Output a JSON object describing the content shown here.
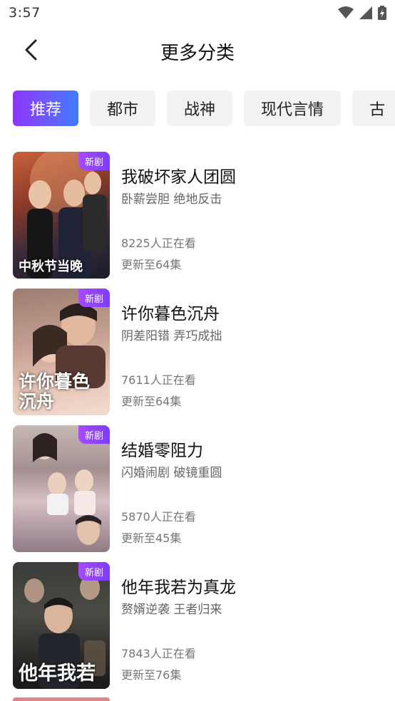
{
  "status": {
    "time": "3:57"
  },
  "header": {
    "title": "更多分类"
  },
  "tabs": [
    {
      "label": "推荐",
      "active": true
    },
    {
      "label": "都市",
      "active": false
    },
    {
      "label": "战神",
      "active": false
    },
    {
      "label": "现代言情",
      "active": false
    },
    {
      "label": "古",
      "active": false
    }
  ],
  "colors": {
    "accent_start": "#8b35ff",
    "accent_end": "#3f7dff",
    "badge": "#9a45ff"
  },
  "dramas": [
    {
      "badge": "新剧",
      "cover_text": "中秋节当晚",
      "title": "我破坏家人团圆",
      "tags": "卧薪尝胆 绝地反击",
      "viewers": "8225人正在看",
      "episodes": "更新至64集"
    },
    {
      "badge": "新剧",
      "cover_text": "许你暮色沉舟",
      "title": "许你暮色沉舟",
      "tags": "阴差阳错 弄巧成拙",
      "viewers": "7611人正在看",
      "episodes": "更新至64集"
    },
    {
      "badge": "新剧",
      "cover_text": "",
      "title": "结婚零阻力",
      "tags": "闪婚闹剧 破镜重圆",
      "viewers": "5870人正在看",
      "episodes": "更新至45集"
    },
    {
      "badge": "新剧",
      "cover_text": "他年我若",
      "title": "他年我若为真龙",
      "tags": "赘婿逆袭 王者归来",
      "viewers": "7843人正在看",
      "episodes": "更新至76集"
    }
  ]
}
